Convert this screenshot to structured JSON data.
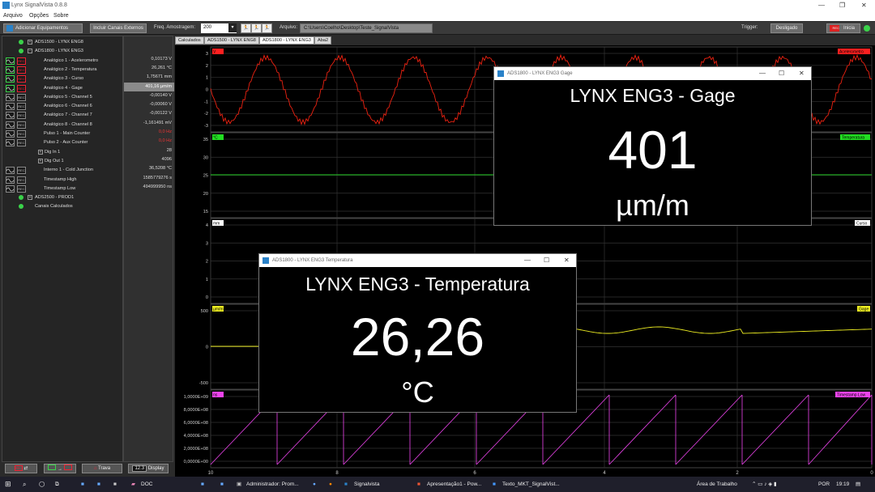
{
  "window": {
    "title": "Lynx SignalVista 0.8.8",
    "controls": [
      "—",
      "❐",
      "✕"
    ]
  },
  "menu": [
    "Arquivo",
    "Opções",
    "Sobre"
  ],
  "toolbar": {
    "add_equipment": "Adicionar Equipamentos",
    "include_external": "Incluir Canais Externos",
    "freq_label": "Freq. Amostragem:",
    "freq_value": "200",
    "file_label": "Arquivo:",
    "file_value": "C:\\Users\\Coelho\\Desktop\\Teste_SignalVista",
    "trigger_label": "Trigger:",
    "trigger_value": "Desligado",
    "start_label": "Inicia"
  },
  "tree": [
    {
      "name": "ADS1500 - LYNX ENG8",
      "kind": "device",
      "value": ""
    },
    {
      "name": "ADS1800 - LYNX ENG3",
      "kind": "device-open",
      "value": ""
    },
    {
      "name": "Analógico 1 - Acelerometro",
      "kind": "channel",
      "rec": true,
      "value": "0,10173 V"
    },
    {
      "name": "Analógico 2 - Temperatura",
      "kind": "channel",
      "rec": true,
      "value": "26,261 °C"
    },
    {
      "name": "Analógico 3 - Curso",
      "kind": "channel",
      "rec": true,
      "value": "1,75671 mm"
    },
    {
      "name": "Analógico 4 - Gage",
      "kind": "channel",
      "rec": true,
      "selected": true,
      "value": "401,16 µm/m"
    },
    {
      "name": "Analógico 5 - Channel 5",
      "kind": "channel",
      "rec": false,
      "value": "-0,00140 V"
    },
    {
      "name": "Analógico 6 - Channel 6",
      "kind": "channel",
      "rec": false,
      "value": "-0,00060 V"
    },
    {
      "name": "Analógico 7 - Channel 7",
      "kind": "channel",
      "rec": false,
      "value": "-0,00122 V"
    },
    {
      "name": "Analógico 8 - Channel 8",
      "kind": "channel",
      "rec": false,
      "value": "-1,161491 mV"
    },
    {
      "name": "Pulso 1 - Main Counter",
      "kind": "channel",
      "rec": false,
      "value": "0,0 Hz",
      "red": true
    },
    {
      "name": "Pulso 2 - Aux Counter",
      "kind": "channel",
      "rec": false,
      "value": "0,0 Hz",
      "red": true
    },
    {
      "name": "Dig In 1",
      "kind": "folder",
      "value": "28"
    },
    {
      "name": "Dig Out 1",
      "kind": "folder",
      "value": "4096"
    },
    {
      "name": "Interno 1 - Cold Junction",
      "kind": "channel",
      "rec": false,
      "value": "36,5208 °C"
    },
    {
      "name": "Timestamp High",
      "kind": "channel",
      "rec": false,
      "value": "1585779276 s"
    },
    {
      "name": "Timestamp Low",
      "kind": "channel",
      "rec": false,
      "value": "494999950 ns"
    },
    {
      "name": "ADS2500 - PROD1",
      "kind": "device",
      "value": ""
    },
    {
      "name": "Canais Calculados",
      "kind": "device-plain",
      "value": ""
    }
  ],
  "bottom": {
    "trava": "Trava",
    "display_num": "12.3",
    "display": "Display"
  },
  "tabs": [
    "Calculados",
    "ADS1500 - LYNX ENG8",
    "ADS1800 - LYNX ENG3",
    "Aba2"
  ],
  "active_tab": 2,
  "plots": [
    {
      "unit": "V",
      "name": "Acelerometro",
      "color": "#ff2020",
      "ticks": [
        "3",
        "2",
        "1",
        "0",
        "-1",
        "-2",
        "-3"
      ]
    },
    {
      "unit": "°C",
      "name": "Temperatura",
      "color": "#22dd22",
      "ticks": [
        "35",
        "30",
        "25",
        "20",
        "15"
      ]
    },
    {
      "unit": "mm",
      "name": "Curso",
      "color": "#ffffff",
      "ticks": [
        "4",
        "3",
        "2",
        "1",
        "0"
      ]
    },
    {
      "unit": "µm/m",
      "name": "Gage",
      "color": "#eeee22",
      "ticks": [
        "500",
        "0",
        "-500"
      ]
    },
    {
      "unit": "ns",
      "name": "Timestamp Low",
      "color": "#ee44ee",
      "ticks": [
        "1,0000E+09",
        "8,0000E+08",
        "6,0000E+08",
        "4,0000E+08",
        "2,0000E+08",
        "0,0000E+00"
      ]
    }
  ],
  "x_ticks": [
    "10",
    "8",
    "6",
    "4",
    "2",
    "0"
  ],
  "popup_gage": {
    "title": "ADS1800 - LYNX ENG3  Gage",
    "heading": "LYNX ENG3 - Gage",
    "value": "401",
    "unit": "µm/m"
  },
  "popup_temp": {
    "title": "ADS1800 - LYNX ENG3  Temperatura",
    "heading": "LYNX ENG3 - Temperatura",
    "value": "26,26",
    "unit": "°C"
  },
  "taskbar": {
    "items": [
      "DOC",
      "Administrador: Prom...",
      "Signalvista",
      "Apresentação1 - Pow...",
      "Texto_MKT_SignalVist..."
    ],
    "area": "Área de Trabalho",
    "lang": "POR",
    "time": "19:19"
  }
}
